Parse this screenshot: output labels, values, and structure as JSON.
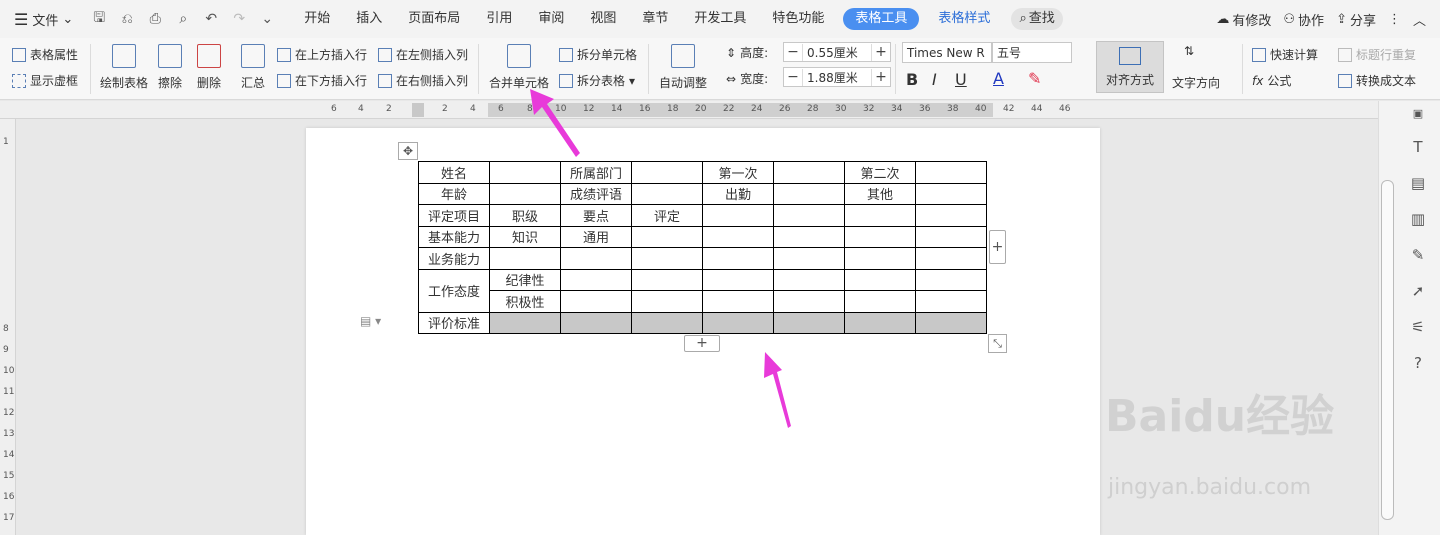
{
  "menubar": {
    "file_label": "文件",
    "tabs": [
      "开始",
      "插入",
      "页面布局",
      "引用",
      "审阅",
      "视图",
      "章节",
      "开发工具",
      "特色功能"
    ],
    "active_tab": "表格工具",
    "table_style_tab": "表格样式",
    "search_label": "查找",
    "actions": {
      "modified": "有修改",
      "collab": "协作",
      "share": "分享"
    }
  },
  "ribbon": {
    "table_props": "表格属性",
    "show_gridlines": "显示虚框",
    "draw_table": "绘制表格",
    "erase": "擦除",
    "delete": "删除",
    "summary": "汇总",
    "insert_above": "在上方插入行",
    "insert_below": "在下方插入行",
    "insert_left": "在左侧插入列",
    "insert_right": "在右侧插入列",
    "merge_cells": "合并单元格",
    "split_cells": "拆分单元格",
    "split_table": "拆分表格",
    "auto_fit": "自动调整",
    "height_label": "高度:",
    "height_value": "0.55厘米",
    "width_label": "宽度:",
    "width_value": "1.88厘米",
    "font_name": "Times New R",
    "font_size": "五号",
    "align": "对齐方式",
    "text_direction": "文字方向",
    "quick_calc": "快速计算",
    "repeat_header": "标题行重复",
    "formula": "公式",
    "to_text": "转换成文本"
  },
  "ruler": {
    "numbers": [
      "6",
      "4",
      "2",
      "2",
      "4",
      "6",
      "8",
      "10",
      "12",
      "14",
      "16",
      "18",
      "20",
      "22",
      "24",
      "26",
      "28",
      "30",
      "32",
      "34",
      "36",
      "38",
      "40",
      "42",
      "44",
      "46"
    ],
    "vnumbers": [
      "1",
      "8",
      "9",
      "10",
      "11",
      "12",
      "13",
      "14",
      "15",
      "16",
      "17"
    ]
  },
  "table": {
    "rows": [
      [
        "姓名",
        "",
        "所属部门",
        "",
        "第一次",
        "",
        "第二次",
        ""
      ],
      [
        "年龄",
        "",
        "成绩评语",
        "",
        "出勤",
        "",
        "其他",
        ""
      ],
      [
        "评定项目",
        "职级",
        "要点",
        "评定",
        "",
        "",
        "",
        ""
      ],
      [
        "基本能力",
        "知识",
        "通用",
        "",
        "",
        "",
        "",
        ""
      ],
      [
        "业务能力",
        "",
        "",
        "",
        "",
        "",
        "",
        ""
      ]
    ],
    "attitude_label": "工作态度",
    "attitude_rows": [
      [
        "纪律性",
        "",
        "",
        "",
        "",
        "",
        ""
      ],
      [
        "积极性",
        "",
        "",
        "",
        "",
        "",
        ""
      ]
    ],
    "eval_label": "评价标准"
  },
  "watermark": {
    "brand": "Baidu经验",
    "url": "jingyan.baidu.com"
  },
  "colors": {
    "accent": "#4a8ff0",
    "arrow": "#e83ad9",
    "selected_row": "#c8c8c8"
  }
}
